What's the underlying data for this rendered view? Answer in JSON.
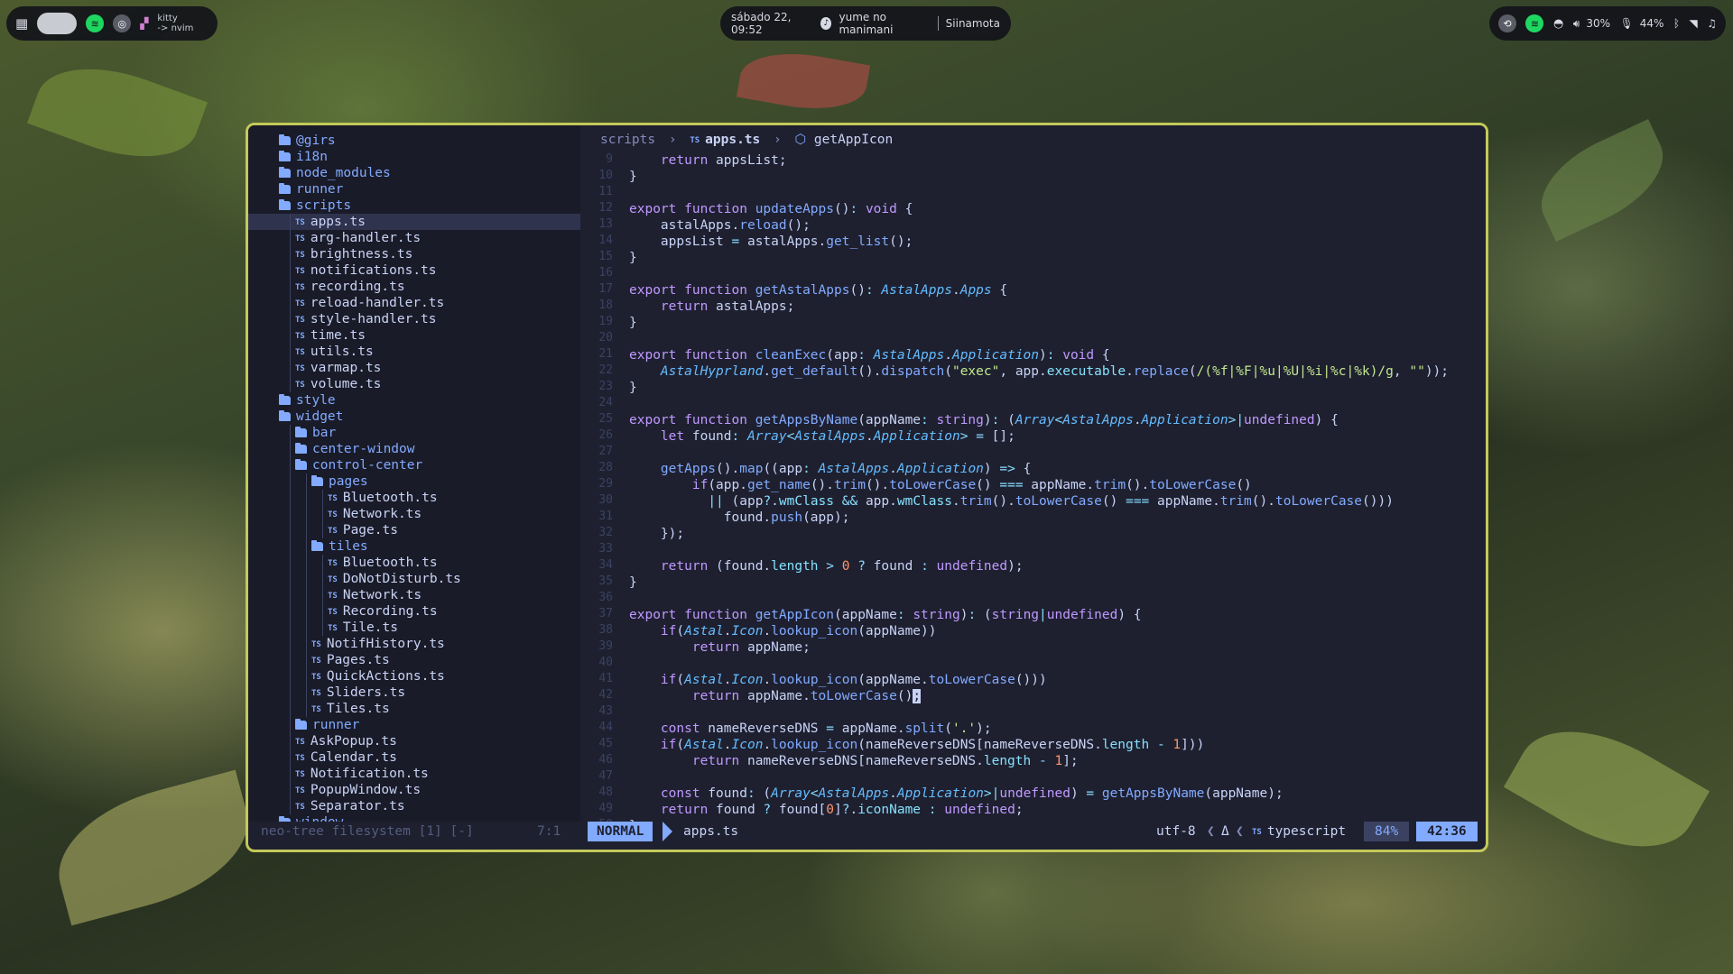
{
  "topbar": {
    "left": {
      "app_line1": "kitty",
      "app_line2": "-> nvim"
    },
    "center": {
      "datetime": "sábado 22, 09:52",
      "track": "yume no manimani",
      "artist": "Siinamota"
    },
    "right": {
      "volume": "30%",
      "mic": "44%"
    }
  },
  "tree": {
    "footer": "neo-tree filesystem [1] [-]",
    "cursor_pos": "7:1",
    "rows": [
      {
        "name": "@girs",
        "type": "dir",
        "depth": 0
      },
      {
        "name": "i18n",
        "type": "dir",
        "depth": 0
      },
      {
        "name": "node_modules",
        "type": "dir",
        "depth": 0
      },
      {
        "name": "runner",
        "type": "dir",
        "depth": 0
      },
      {
        "name": "scripts",
        "type": "dir-open",
        "depth": 0
      },
      {
        "name": "apps.ts",
        "type": "ts",
        "depth": 1,
        "selected": true
      },
      {
        "name": "arg-handler.ts",
        "type": "ts",
        "depth": 1
      },
      {
        "name": "brightness.ts",
        "type": "ts",
        "depth": 1
      },
      {
        "name": "notifications.ts",
        "type": "ts",
        "depth": 1
      },
      {
        "name": "recording.ts",
        "type": "ts",
        "depth": 1
      },
      {
        "name": "reload-handler.ts",
        "type": "ts",
        "depth": 1
      },
      {
        "name": "style-handler.ts",
        "type": "ts",
        "depth": 1
      },
      {
        "name": "time.ts",
        "type": "ts",
        "depth": 1
      },
      {
        "name": "utils.ts",
        "type": "ts",
        "depth": 1
      },
      {
        "name": "varmap.ts",
        "type": "ts",
        "depth": 1
      },
      {
        "name": "volume.ts",
        "type": "ts",
        "depth": 1
      },
      {
        "name": "style",
        "type": "dir",
        "depth": 0
      },
      {
        "name": "widget",
        "type": "dir-open",
        "depth": 0
      },
      {
        "name": "bar",
        "type": "dir",
        "depth": 1
      },
      {
        "name": "center-window",
        "type": "dir",
        "depth": 1
      },
      {
        "name": "control-center",
        "type": "dir-open",
        "depth": 1
      },
      {
        "name": "pages",
        "type": "dir-open",
        "depth": 2
      },
      {
        "name": "Bluetooth.ts",
        "type": "ts",
        "depth": 3
      },
      {
        "name": "Network.ts",
        "type": "ts",
        "depth": 3
      },
      {
        "name": "Page.ts",
        "type": "ts",
        "depth": 3
      },
      {
        "name": "tiles",
        "type": "dir-open",
        "depth": 2
      },
      {
        "name": "Bluetooth.ts",
        "type": "ts",
        "depth": 3
      },
      {
        "name": "DoNotDisturb.ts",
        "type": "ts",
        "depth": 3
      },
      {
        "name": "Network.ts",
        "type": "ts",
        "depth": 3
      },
      {
        "name": "Recording.ts",
        "type": "ts",
        "depth": 3
      },
      {
        "name": "Tile.ts",
        "type": "ts",
        "depth": 3
      },
      {
        "name": "NotifHistory.ts",
        "type": "ts",
        "depth": 2
      },
      {
        "name": "Pages.ts",
        "type": "ts",
        "depth": 2
      },
      {
        "name": "QuickActions.ts",
        "type": "ts",
        "depth": 2
      },
      {
        "name": "Sliders.ts",
        "type": "ts",
        "depth": 2
      },
      {
        "name": "Tiles.ts",
        "type": "ts",
        "depth": 2
      },
      {
        "name": "runner",
        "type": "dir",
        "depth": 1
      },
      {
        "name": "AskPopup.ts",
        "type": "ts",
        "depth": 1
      },
      {
        "name": "Calendar.ts",
        "type": "ts",
        "depth": 1
      },
      {
        "name": "Notification.ts",
        "type": "ts",
        "depth": 1
      },
      {
        "name": "PopupWindow.ts",
        "type": "ts",
        "depth": 1
      },
      {
        "name": "Separator.ts",
        "type": "ts",
        "depth": 1
      },
      {
        "name": "window",
        "type": "dir",
        "depth": 0
      }
    ]
  },
  "editor": {
    "breadcrumb": {
      "dir": "scripts",
      "file": "apps.ts",
      "symbol": "getAppIcon"
    },
    "first_line": 9,
    "lines": [
      "    return appsList;",
      "}",
      "",
      "export function updateApps(): void {",
      "    astalApps.reload();",
      "    appsList = astalApps.get_list();",
      "}",
      "",
      "export function getAstalApps(): AstalApps.Apps {",
      "    return astalApps;",
      "}",
      "",
      "export function cleanExec(app: AstalApps.Application): void {",
      "    AstalHyprland.get_default().dispatch(\"exec\", app.executable.replace(/(%f|%F|%u|%U|%i|%c|%k)/g, \"\"));",
      "}",
      "",
      "export function getAppsByName(appName: string): (Array<AstalApps.Application>|undefined) {",
      "    let found: Array<AstalApps.Application> = [];",
      "",
      "    getApps().map((app: AstalApps.Application) => {",
      "        if(app.get_name().trim().toLowerCase() === appName.trim().toLowerCase()",
      "          || (app?.wmClass && app.wmClass.trim().toLowerCase() === appName.trim().toLowerCase()))",
      "            found.push(app);",
      "    });",
      "",
      "    return (found.length > 0 ? found : undefined);",
      "}",
      "",
      "export function getAppIcon(appName: string): (string|undefined) {",
      "    if(Astal.Icon.lookup_icon(appName))",
      "        return appName;",
      "",
      "    if(Astal.Icon.lookup_icon(appName.toLowerCase()))",
      "        return appName.toLowerCase();",
      "",
      "    const nameReverseDNS = appName.split('.');",
      "    if(Astal.Icon.lookup_icon(nameReverseDNS[nameReverseDNS.length - 1]))",
      "        return nameReverseDNS[nameReverseDNS.length - 1];",
      "",
      "    const found: (Array<AstalApps.Application>|undefined) = getAppsByName(appName);",
      "    return found ? found[0]?.iconName : undefined;",
      "}"
    ]
  },
  "status": {
    "mode": "NORMAL",
    "file": "apps.ts",
    "encoding": "utf-8",
    "filetype": "typescript",
    "percent": "84%",
    "position": "42:36"
  },
  "colors": {
    "accent": "#82aaff",
    "border": "#c3c95a",
    "bg": "#1e2030"
  }
}
